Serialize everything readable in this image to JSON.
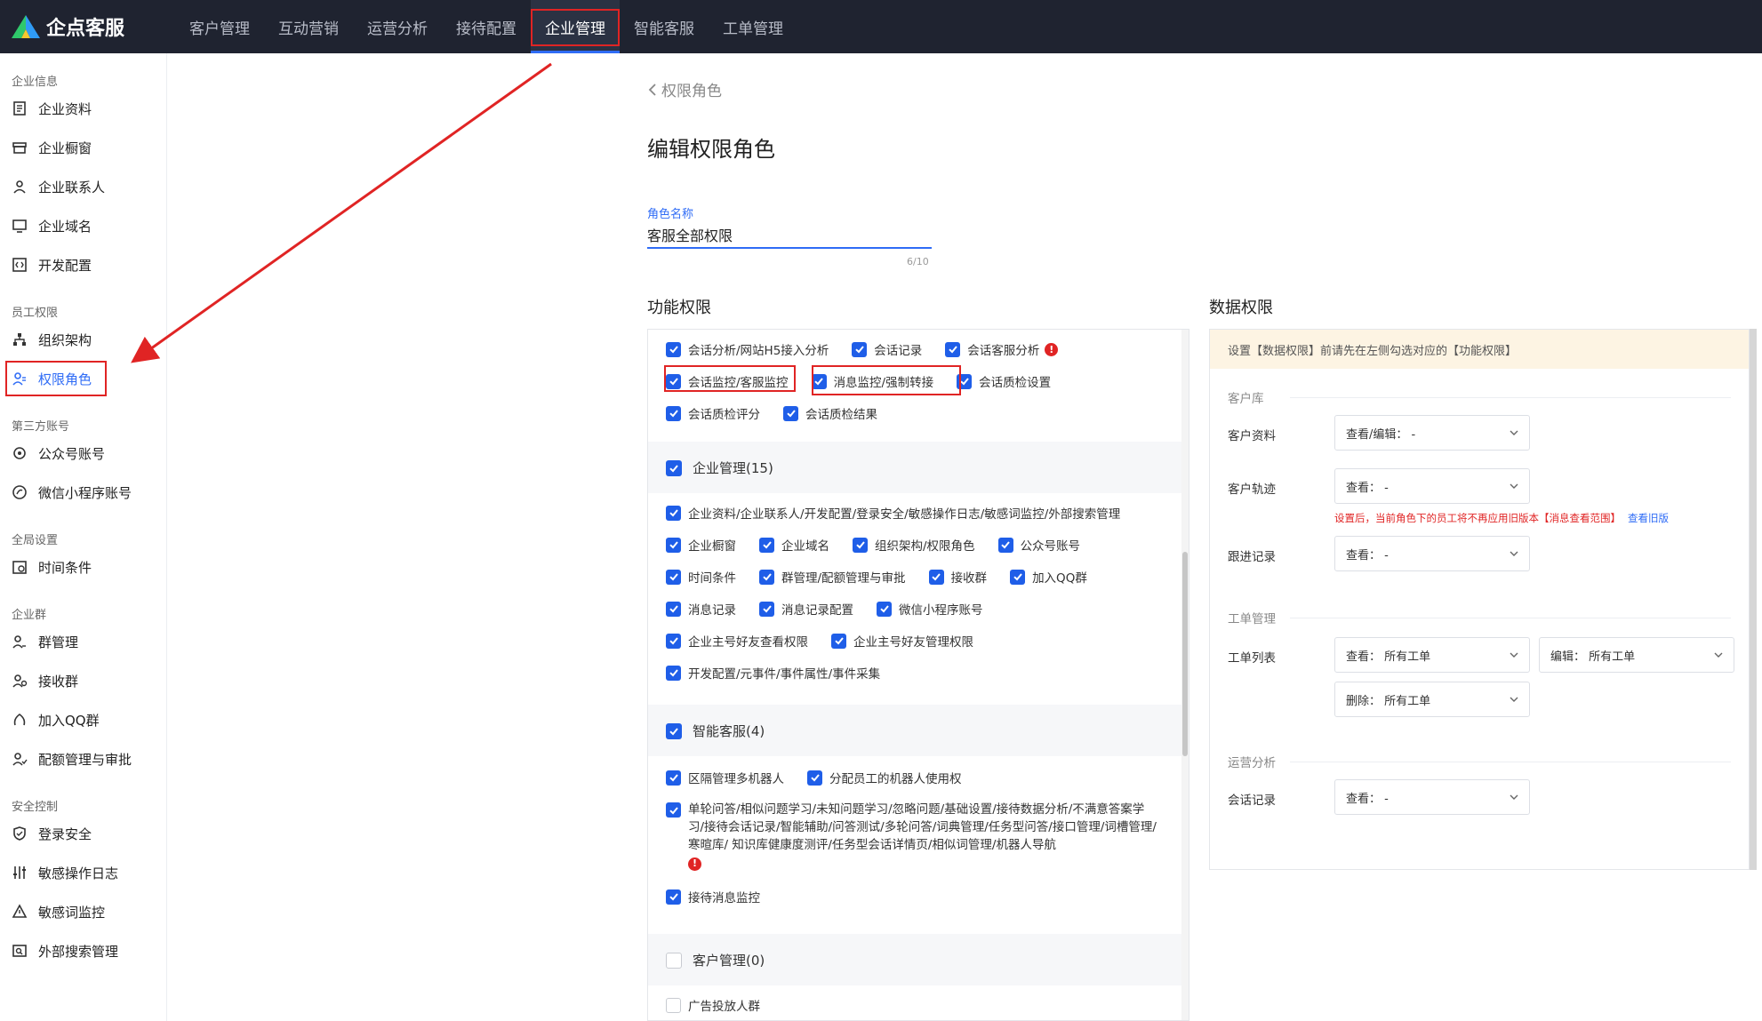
{
  "app": {
    "name": "企点客服"
  },
  "nav": [
    "客户管理",
    "互动营销",
    "运营分析",
    "接待配置",
    "企业管理",
    "智能客服",
    "工单管理"
  ],
  "nav_active": 4,
  "sidebar": {
    "groups": [
      {
        "title": "企业信息",
        "items": [
          {
            "label": "企业资料",
            "icon": "file-icon"
          },
          {
            "label": "企业橱窗",
            "icon": "shop-icon"
          },
          {
            "label": "企业联系人",
            "icon": "contact-icon"
          },
          {
            "label": "企业域名",
            "icon": "domain-icon"
          },
          {
            "label": "开发配置",
            "icon": "code-icon"
          }
        ]
      },
      {
        "title": "员工权限",
        "items": [
          {
            "label": "组织架构",
            "icon": "org-icon"
          },
          {
            "label": "权限角色",
            "icon": "role-icon",
            "active": true
          }
        ]
      },
      {
        "title": "第三方账号",
        "items": [
          {
            "label": "公众号账号",
            "icon": "official-account-icon"
          },
          {
            "label": "微信小程序账号",
            "icon": "miniprogram-icon"
          }
        ]
      },
      {
        "title": "全局设置",
        "items": [
          {
            "label": "时间条件",
            "icon": "calendar-icon"
          }
        ]
      },
      {
        "title": "企业群",
        "items": [
          {
            "label": "群管理",
            "icon": "group-icon"
          },
          {
            "label": "接收群",
            "icon": "receive-group-icon"
          },
          {
            "label": "加入QQ群",
            "icon": "qq-group-icon"
          },
          {
            "label": "配额管理与审批",
            "icon": "quota-icon"
          }
        ]
      },
      {
        "title": "安全控制",
        "items": [
          {
            "label": "登录安全",
            "icon": "shield-icon"
          },
          {
            "label": "敏感操作日志",
            "icon": "sliders-icon"
          },
          {
            "label": "敏感词监控",
            "icon": "warning-icon"
          },
          {
            "label": "外部搜索管理",
            "icon": "search-box-icon"
          }
        ]
      }
    ]
  },
  "page": {
    "back_label": "权限角色",
    "title": "编辑权限角色",
    "role_name_label": "角色名称",
    "role_name_value": "客服全部权限",
    "role_name_count": "6/10",
    "func_title": "功能权限",
    "data_title": "数据权限"
  },
  "func": {
    "row1": [
      "会话分析/网站H5接入分析",
      "会话记录",
      "会话客服分析"
    ],
    "row2": [
      "会话监控/客服监控",
      "消息监控/强制转接",
      "会话质检设置"
    ],
    "row3": [
      "会话质检评分",
      "会话质检结果"
    ],
    "cat_enterprise": "企业管理(15)",
    "ent_rows": [
      [
        "企业资料/企业联系人/开发配置/登录安全/敏感操作日志/敏感词监控/外部搜索管理"
      ],
      [
        "企业橱窗",
        "企业域名",
        "组织架构/权限角色",
        "公众号账号"
      ],
      [
        "时间条件",
        "群管理/配额管理与审批",
        "接收群",
        "加入QQ群"
      ],
      [
        "消息记录",
        "消息记录配置",
        "微信小程序账号"
      ],
      [
        "企业主号好友查看权限",
        "企业主号好友管理权限"
      ],
      [
        "开发配置/元事件/事件属性/事件采集"
      ]
    ],
    "cat_smart": "智能客服(4)",
    "smart_row1": [
      "区隔管理多机器人",
      "分配员工的机器人使用权"
    ],
    "smart_long": "单轮问答/相似问题学习/未知问题学习/忽略问题/基础设置/接待数据分析/不满意答案学习/接待会话记录/智能辅助/问答测试/多轮问答/词典管理/任务型问答/接口管理/词槽管理/寒暄库/ 知识库健康度测评/任务型会话详情页/相似词管理/机器人导航",
    "smart_row3": "接待消息监控",
    "cat_customer": "客户管理(0)",
    "cust_row1": "广告投放人群"
  },
  "data": {
    "notice": "设置【数据权限】前请先在左侧勾选对应的【功能权限】",
    "group_customer": "客户库",
    "customer_profile_label": "客户资料",
    "customer_profile_value": "查看/编辑： -",
    "customer_track_label": "客户轨迹",
    "customer_track_value": "查看： -",
    "hint_text": "设置后，当前角色下的员工将不再应用旧版本【消息查看范围】",
    "hint_link": "查看旧版",
    "followup_label": "跟进记录",
    "followup_value": "查看： -",
    "group_ticket": "工单管理",
    "ticket_list_label": "工单列表",
    "ticket_view_value": "查看： 所有工单",
    "ticket_edit_value": "编辑： 所有工单",
    "ticket_delete_value": "删除： 所有工单",
    "group_ops": "运营分析",
    "session_record_label": "会话记录",
    "session_record_value": "查看： -"
  },
  "colors": {
    "accent": "#2f6cf6",
    "checkbox": "#1f5ee8",
    "highlight": "#e02424",
    "topbar": "#1f2330"
  }
}
